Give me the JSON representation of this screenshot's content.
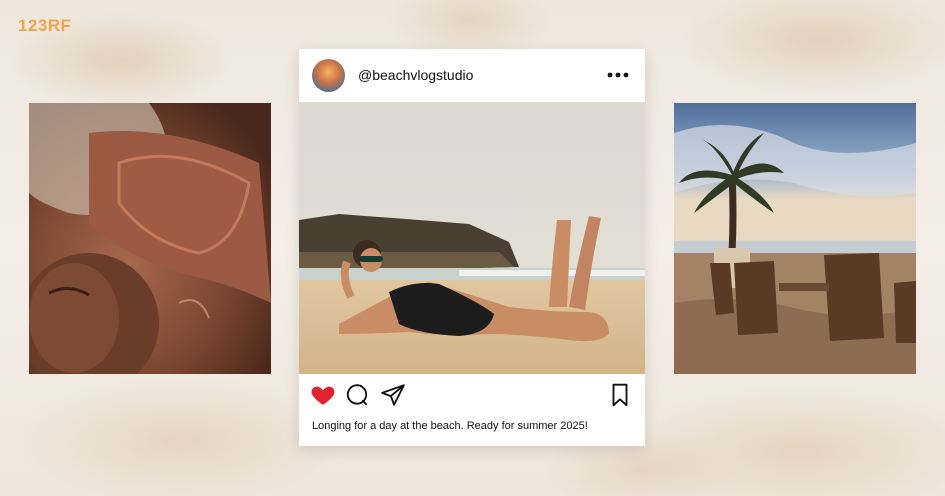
{
  "watermark": {
    "text": "123RF"
  },
  "post": {
    "username": "@beachvlogstudio",
    "caption": "Longing for a day at the beach. Ready for summer 2025!",
    "liked": true
  },
  "icons": {
    "more": "more-options-icon",
    "like": "heart-icon",
    "comment": "comment-icon",
    "share": "send-icon",
    "save": "bookmark-icon"
  },
  "colors": {
    "accent_heart": "#e0242f",
    "watermark": "#f3a34a",
    "card_bg": "#ffffff"
  }
}
